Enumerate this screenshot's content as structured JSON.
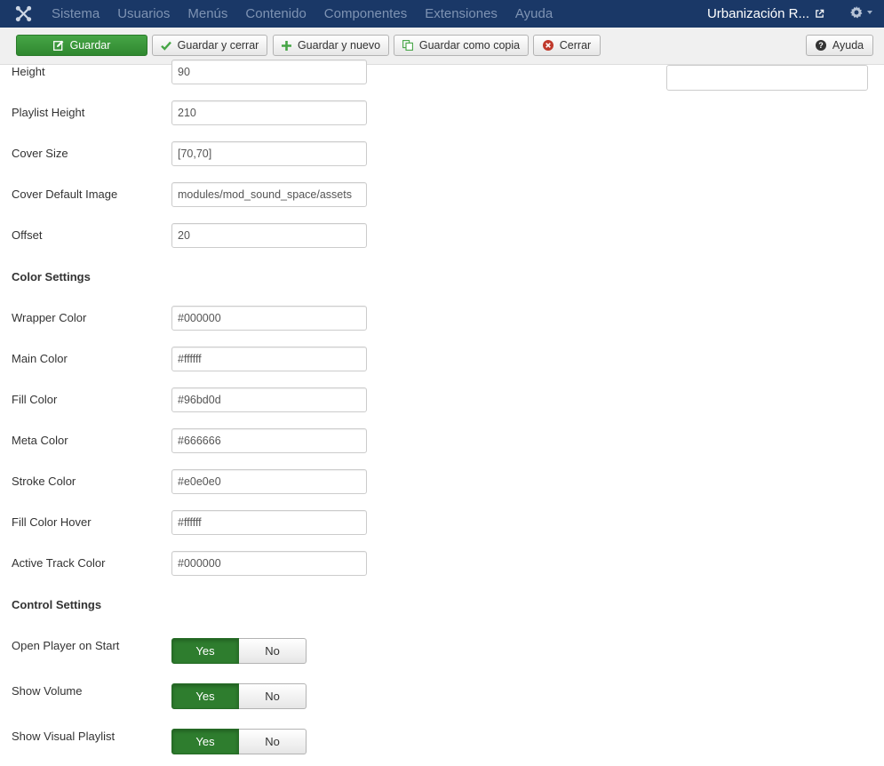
{
  "navbar": {
    "menu": [
      "Sistema",
      "Usuarios",
      "Menús",
      "Contenido",
      "Componentes",
      "Extensiones",
      "Ayuda"
    ],
    "site_name": "Urbanización R...",
    "logo_icon": "joomla-logo-icon",
    "settings_icon": "gear-icon"
  },
  "toolbar": {
    "save": "Guardar",
    "save_close": "Guardar y cerrar",
    "save_new": "Guardar y nuevo",
    "save_copy": "Guardar como copia",
    "close": "Cerrar",
    "help": "Ayuda"
  },
  "form": {
    "height": {
      "label": "Height",
      "value": "90"
    },
    "playlist_height": {
      "label": "Playlist Height",
      "value": "210"
    },
    "cover_size": {
      "label": "Cover Size",
      "value": "[70,70]"
    },
    "cover_default_image": {
      "label": "Cover Default Image",
      "value": "modules/mod_sound_space/assets"
    },
    "offset": {
      "label": "Offset",
      "value": "20"
    },
    "color_settings": "Color Settings",
    "wrapper_color": {
      "label": "Wrapper Color",
      "value": "#000000"
    },
    "main_color": {
      "label": "Main Color",
      "value": "#ffffff"
    },
    "fill_color": {
      "label": "Fill Color",
      "value": "#96bd0d"
    },
    "meta_color": {
      "label": "Meta Color",
      "value": "#666666"
    },
    "stroke_color": {
      "label": "Stroke Color",
      "value": "#e0e0e0"
    },
    "fill_color_hover": {
      "label": "Fill Color Hover",
      "value": "#ffffff"
    },
    "active_track_color": {
      "label": "Active Track Color",
      "value": "#000000"
    },
    "control_settings": "Control Settings",
    "open_player": {
      "label": "Open Player on Start",
      "yes": "Yes",
      "no": "No",
      "selected": "Yes"
    },
    "show_volume": {
      "label": "Show Volume",
      "yes": "Yes",
      "no": "No",
      "selected": "Yes"
    },
    "show_visual_playlist": {
      "label": "Show Visual Playlist",
      "yes": "Yes",
      "no": "No",
      "selected": "Yes"
    }
  },
  "sidebar": {
    "input_value": ""
  },
  "colors": {
    "navbar_bg": "#1a3867",
    "save_green": "#46a546",
    "toggle_yes": "#2e7d2e"
  }
}
